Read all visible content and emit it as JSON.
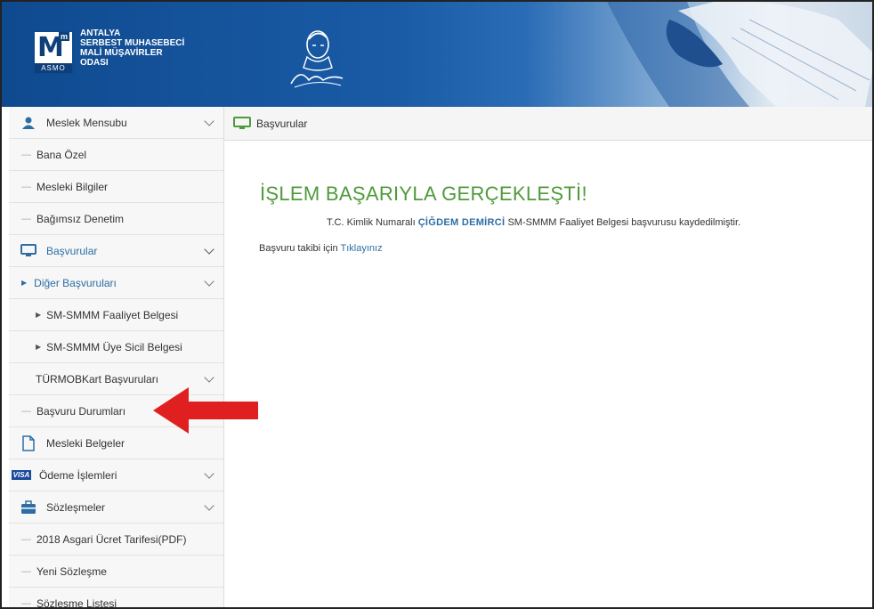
{
  "org": {
    "logo_letter": "M",
    "logo_sup": "m",
    "logo_abbr": "ASMO",
    "name_lines": [
      "ANTALYA",
      "SERBEST MUHASEBECİ",
      "MALİ MÜŞAVİRLER",
      "ODASI"
    ]
  },
  "sidebar": {
    "items": [
      {
        "label": "Meslek Mensubu",
        "icon": "user-icon"
      },
      {
        "label": "Bana Özel"
      },
      {
        "label": "Mesleki Bilgiler"
      },
      {
        "label": "Bağımsız Denetim"
      },
      {
        "label": "Başvurular",
        "icon": "monitor-icon"
      },
      {
        "label": "Diğer Başvuruları"
      },
      {
        "label": "SM-SMMM Faaliyet Belgesi"
      },
      {
        "label": "SM-SMMM Üye Sicil Belgesi"
      },
      {
        "label": "TÜRMOBKart Başvuruları"
      },
      {
        "label": "Başvuru Durumları"
      },
      {
        "label": "Mesleki Belgeler",
        "icon": "document-icon"
      },
      {
        "label": "Ödeme İşlemleri",
        "icon": "visa-icon"
      },
      {
        "label": "Sözleşmeler",
        "icon": "briefcase-icon"
      },
      {
        "label": "2018 Asgari Ücret Tarifesi(PDF)"
      },
      {
        "label": "Yeni Sözleşme"
      },
      {
        "label": "Sözleşme Listesi"
      }
    ],
    "visa_text": "VISA"
  },
  "topbar": {
    "title": "Başvurular"
  },
  "main": {
    "success_title": "İŞLEM BAŞARIYLA GERÇEKLEŞTİ!",
    "info_prefix": "T.C. Kimlik Numaralı",
    "person_name": "ÇİĞDEM DEMİRCİ",
    "info_suffix": "SM-SMMM Faaliyet Belgesi başvurusu kaydedilmiştir.",
    "track_prefix": "Başvuru takibi için",
    "track_link": "Tıklayınız"
  },
  "colors": {
    "header_blue": "#1a5ba6",
    "success_green": "#4f9a3a",
    "link_blue": "#2e6da4",
    "arrow_red": "#e02020"
  }
}
